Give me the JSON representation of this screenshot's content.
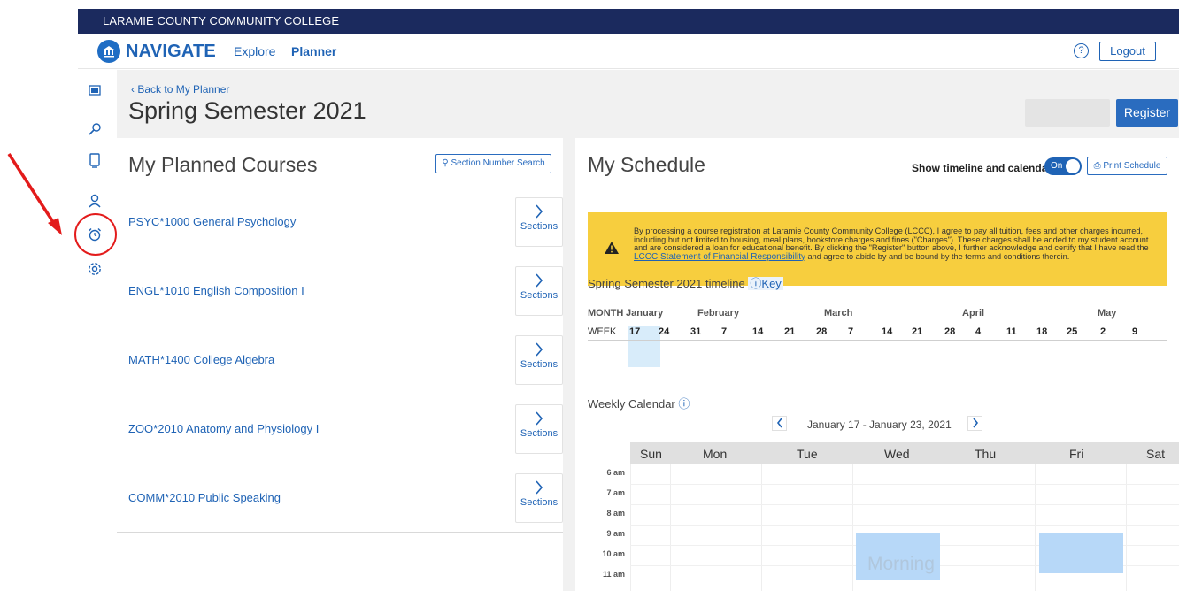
{
  "header": {
    "college_name": "LARAMIE COUNTY COMMUNITY COLLEGE",
    "app_name": "NAVIGATE",
    "nav": [
      "Explore",
      "Planner"
    ],
    "help_icon": "?",
    "logout_label": "Logout"
  },
  "sidebar": {
    "items": [
      "calendar-icon",
      "search-icon",
      "book-icon",
      "person-icon",
      "alarm-clock-icon",
      "gear-icon"
    ]
  },
  "page": {
    "back_link": "Back to My Planner",
    "title": "Spring Semester 2021",
    "register_label": "Register"
  },
  "planned_courses": {
    "title": "My Planned Courses",
    "section_search_label": "Section Number Search",
    "sections_label": "Sections",
    "courses": [
      "PSYC*1000 General Psychology",
      "ENGL*1010 English Composition I",
      "MATH*1400 College Algebra",
      "ZOO*2010 Anatomy and Physiology I",
      "COMM*2010 Public Speaking"
    ]
  },
  "schedule": {
    "title": "My Schedule",
    "show_timeline_label": "Show timeline and calendar",
    "toggle_state": "On",
    "print_label": "Print Schedule",
    "warning_text_1": "By processing a course registration at Laramie County Community College (LCCC), I agree to pay all tuition, fees and other charges incurred, including but not limited to housing, meal plans, bookstore charges and fines (\"Charges\"). These charges shall be added to my student account and are considered a loan for educational benefit. By clicking the \"Register\" button above, I further acknowledge and certify that I have read the ",
    "warning_link": "LCCC Statement of Financial Responsibility",
    "warning_text_2": " and agree to abide by and be bound by the terms and conditions therein.",
    "timeline_title": "Spring Semester 2021 timeline",
    "key_label": "Key",
    "month_label": "MONTH",
    "week_label": "WEEK",
    "months": [
      "January",
      "February",
      "March",
      "April",
      "May"
    ],
    "weeks": [
      "17",
      "24",
      "31",
      "7",
      "14",
      "21",
      "28",
      "7",
      "14",
      "21",
      "28",
      "4",
      "11",
      "18",
      "25",
      "2",
      "9"
    ],
    "weekly_title": "Weekly Calendar",
    "range": "January 17 - January 23, 2021",
    "days": [
      "Sun",
      "Mon",
      "Tue",
      "Wed",
      "Thu",
      "Fri",
      "Sat"
    ],
    "hours": [
      "6 am",
      "7 am",
      "8 am",
      "9 am",
      "10 am",
      "11 am"
    ],
    "event_label": "Morning"
  },
  "colors": {
    "topbar": "#1b2a5e",
    "brand_blue": "#1f63b5",
    "warning_yellow": "#f7ce3e",
    "event_blue": "#b7d8f8",
    "annotation_red": "#e31b1b"
  }
}
